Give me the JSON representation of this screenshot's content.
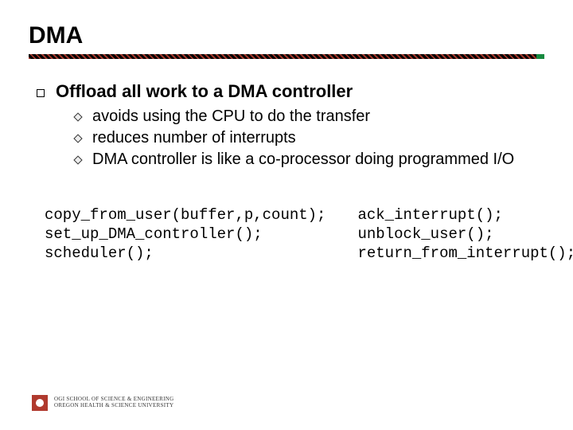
{
  "title": "DMA",
  "bullet": {
    "text": "Offload all work to a DMA controller",
    "subs": [
      "avoids using the CPU to do the transfer",
      "reduces number of interrupts",
      "DMA controller is like a co-processor doing programmed I/O"
    ]
  },
  "code": {
    "left": "copy_from_user(buffer,p,count);\nset_up_DMA_controller();\nscheduler();",
    "right": "ack_interrupt();\nunblock_user();\nreturn_from_interrupt();"
  },
  "footer": {
    "line1": "OGI SCHOOL OF SCIENCE & ENGINEERING",
    "line2": "OREGON HEALTH & SCIENCE UNIVERSITY"
  }
}
